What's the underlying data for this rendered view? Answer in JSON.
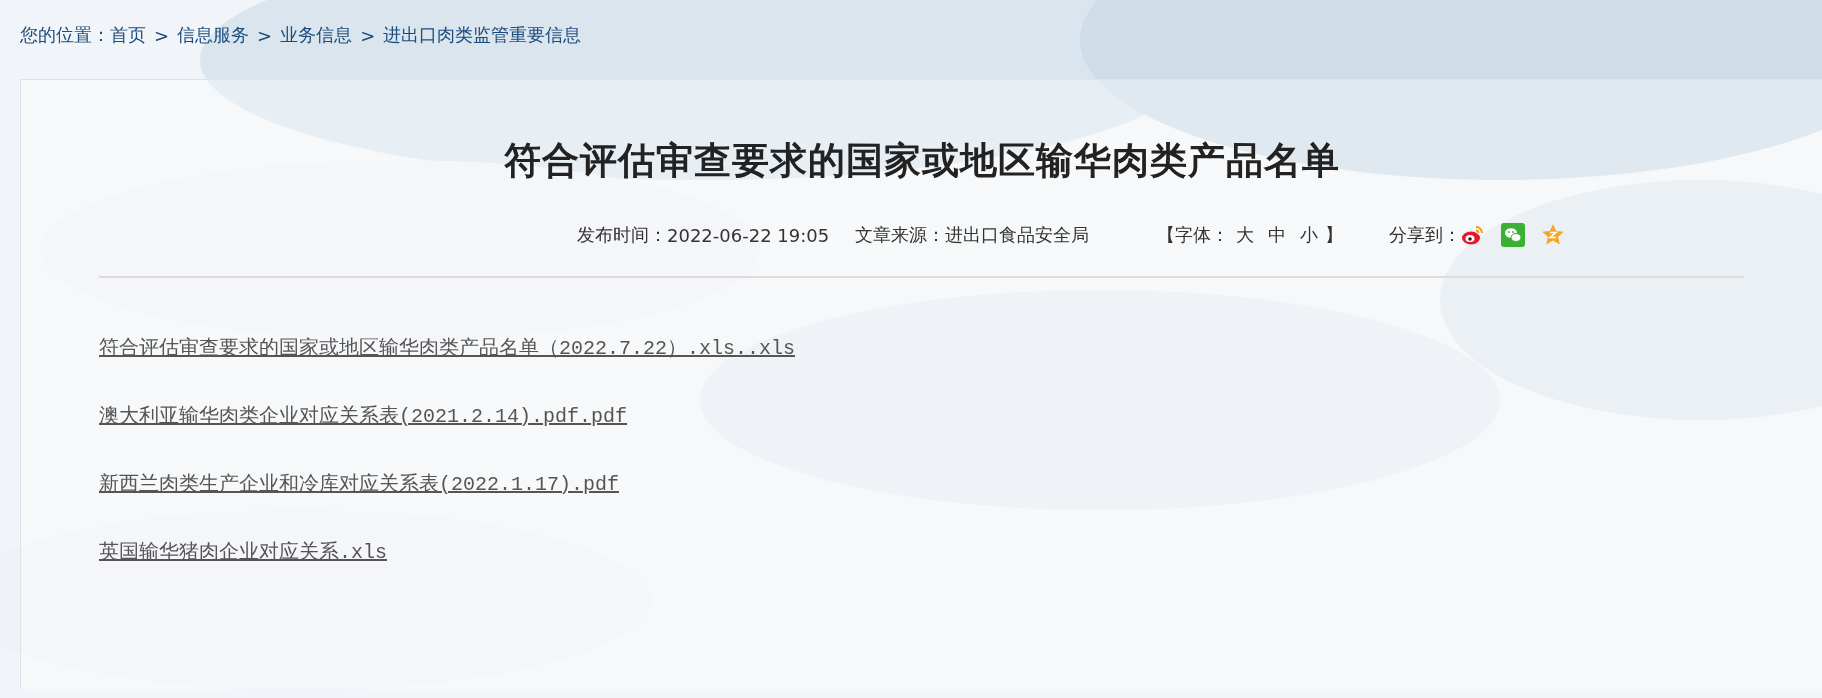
{
  "breadcrumb": {
    "label": "您的位置：",
    "separator": ">",
    "items": [
      "首页",
      "信息服务",
      "业务信息",
      "进出口肉类监管重要信息"
    ]
  },
  "article": {
    "title": "符合评估审查要求的国家或地区输华肉类产品名单",
    "meta": {
      "published_label": "发布时间：",
      "published": "2022-06-22 19:05",
      "source_label": "文章来源：",
      "source": "进出口食品安全局"
    },
    "font_size": {
      "open": "【",
      "label": "字体：",
      "options": [
        "大",
        "中",
        "小"
      ],
      "close": "】"
    },
    "share": {
      "label": "分享到：",
      "targets": [
        {
          "kind": "weibo"
        },
        {
          "kind": "wechat"
        },
        {
          "kind": "qzone"
        }
      ]
    },
    "attachments": [
      {
        "name": "符合评估审查要求的国家或地区输华肉类产品名单（2022.7.22）.xls..xls"
      },
      {
        "name": "澳大利亚输华肉类企业对应关系表(2021.2.14).pdf.pdf"
      },
      {
        "name": "新西兰肉类生产企业和冷库对应关系表(2022.1.17).pdf"
      },
      {
        "name": "英国输华猪肉企业对应关系.xls"
      }
    ]
  }
}
